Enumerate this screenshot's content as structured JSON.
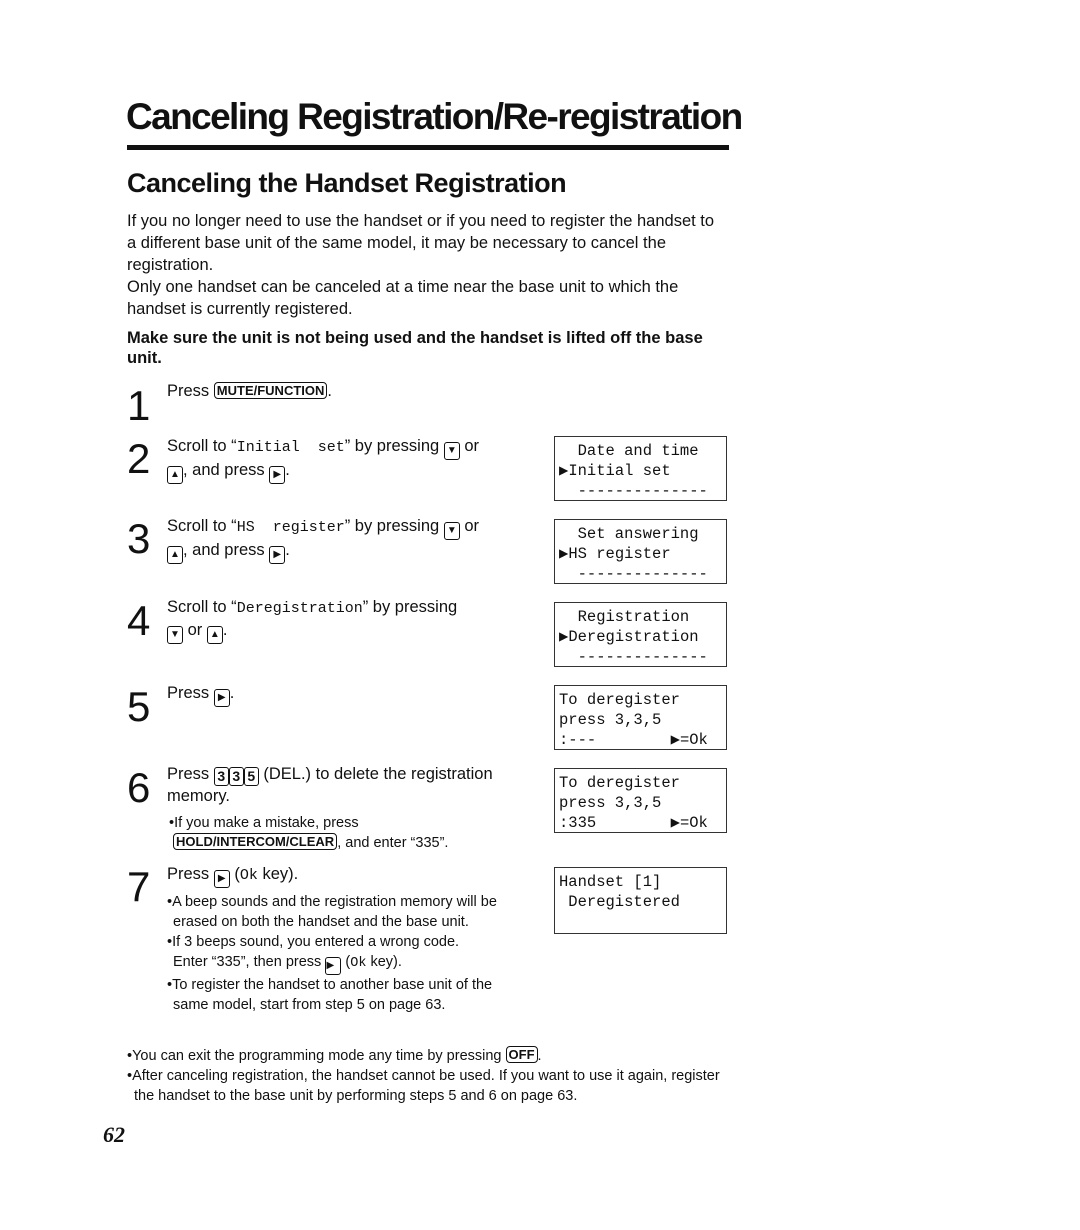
{
  "title": "Canceling Registration/Re-registration",
  "subtitle": "Canceling the Handset Registration",
  "intro": [
    "If you no longer need to use the handset or if you need to register the handset to a different base unit of the same model, it may be necessary to cancel the registration.",
    "Only one handset can be canceled at a time near the base unit to which the handset is currently registered."
  ],
  "warning": "Make sure the unit is not being used and the handset is lifted off the base unit.",
  "keys": {
    "mute_function": "MUTE/FUNCTION",
    "hold_intercom_clear": "HOLD/INTERCOM/CLEAR",
    "off": "OFF",
    "down": "▼",
    "up": "▲",
    "right": "▶",
    "d3": "3",
    "d5": "5"
  },
  "steps": [
    {
      "num": "1",
      "text": "Press",
      "end": "."
    },
    {
      "num": "2",
      "a": "Scroll to “",
      "mono": "Initial  set",
      "b": "” by pressing",
      "or": "or",
      ",": ", and press",
      "end": "."
    },
    {
      "num": "3",
      "a": "Scroll to “",
      "mono": "HS  register",
      "b": "” by pressing",
      "or": "or",
      ",": ", and press",
      "end": "."
    },
    {
      "num": "4",
      "a": "Scroll to “",
      "mono": "Deregistration",
      "b": "” by pressing",
      "or": "or",
      "end": "."
    },
    {
      "num": "5",
      "text": "Press",
      "end": "."
    },
    {
      "num": "6",
      "text": "Press",
      "b": "(DEL.) to delete the registration memory.",
      "sub1": "•If you make a mistake, press",
      "sub2": ", and enter “335”."
    },
    {
      "num": "7",
      "text": "Press",
      "mono": "Ok",
      "b": "key).",
      "open": "(",
      "bullets": [
        "•A beep sounds and the registration memory will be erased on both the handset and the base unit.",
        "•If 3 beeps sound, you entered a wrong code.",
        "Enter “335”, then press",
        "key).",
        "•To register the handset to another base unit of the same model, start from step 5 on page 63."
      ]
    }
  ],
  "displays": [
    "  Date and time\n▶Initial set\n  --------------",
    "  Set answering\n▶HS register\n  --------------",
    "  Registration\n▶Deregistration\n  --------------",
    "To deregister\npress 3,3,5\n:---        ▶=Ok",
    "To deregister\npress 3,3,5\n:335        ▶=Ok",
    "Handset [1]\n Deregistered"
  ],
  "notes": {
    "n1": "•You can exit the programming mode any time by pressing",
    "n1end": ".",
    "n2": "•After canceling registration, the handset cannot be used. If you want to use it again, register the handset to the base unit by performing steps 5 and 6 on page 63."
  },
  "page_number": "62"
}
